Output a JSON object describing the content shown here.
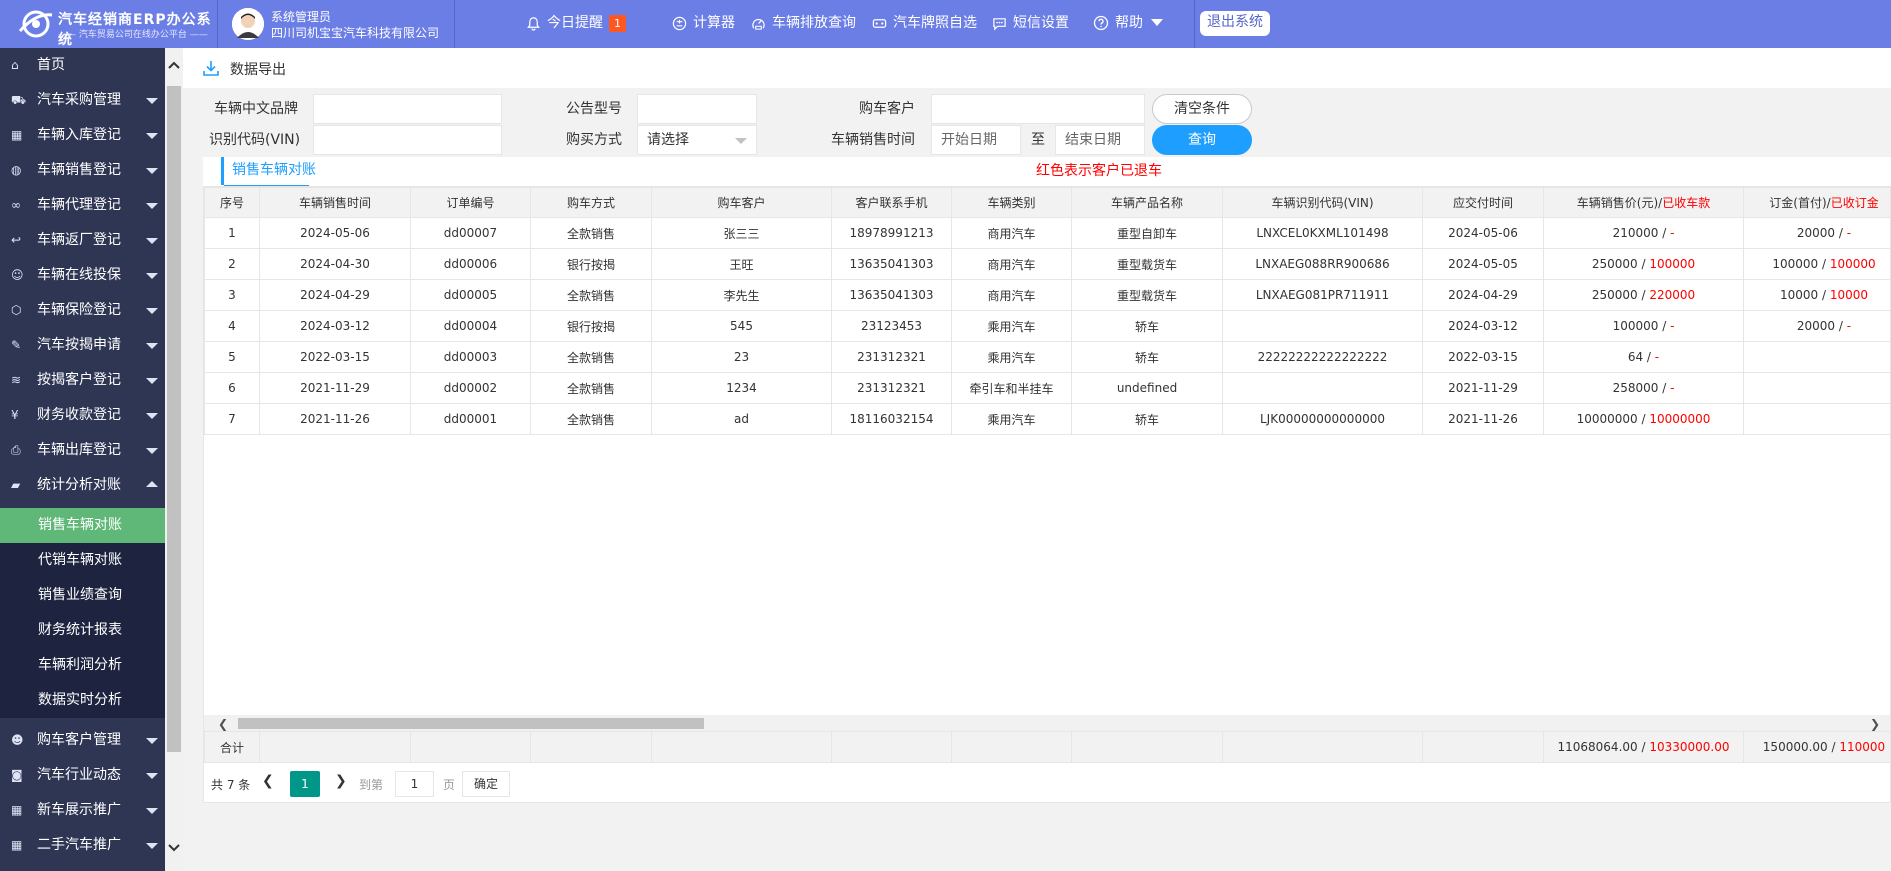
{
  "app": {
    "title": "汽车经销商ERP办公系统",
    "subtitle": "—— 汽车贸易公司在线办公平台 ——"
  },
  "user": {
    "role": "系统管理员",
    "company": "四川司机宝宝汽车科技有限公司"
  },
  "toolbar": {
    "reminder": "今日提醒",
    "reminder_count": "1",
    "calculator": "计算器",
    "emission": "车辆排放查询",
    "plate": "汽车牌照自选",
    "sms": "短信设置",
    "help": "帮助",
    "logout": "退出系统"
  },
  "sidebar": {
    "items": [
      {
        "icon": "home-icon",
        "label": "首页",
        "arrow": ""
      },
      {
        "icon": "cart-icon",
        "label": "汽车采购管理",
        "arrow": "down"
      },
      {
        "icon": "grid-icon",
        "label": "车辆入库登记",
        "arrow": "down"
      },
      {
        "icon": "globe-icon",
        "label": "车辆销售登记",
        "arrow": "down"
      },
      {
        "icon": "link-icon",
        "label": "车辆代理登记",
        "arrow": "down"
      },
      {
        "icon": "return-icon",
        "label": "车辆返厂登记",
        "arrow": "down"
      },
      {
        "icon": "smile-icon",
        "label": "车辆在线投保",
        "arrow": "down"
      },
      {
        "icon": "cube-icon",
        "label": "车辆保险登记",
        "arrow": "down"
      },
      {
        "icon": "edit-icon",
        "label": "汽车按揭申请",
        "arrow": "down"
      },
      {
        "icon": "layers-icon",
        "label": "按揭客户登记",
        "arrow": "down"
      },
      {
        "icon": "yen-icon",
        "label": "财务收款登记",
        "arrow": "down"
      },
      {
        "icon": "print-icon",
        "label": "车辆出库登记",
        "arrow": "down"
      },
      {
        "icon": "chat-icon",
        "label": "统计分析对账",
        "arrow": "up"
      }
    ],
    "subitems": [
      "销售车辆对账",
      "代销车辆对账",
      "销售业绩查询",
      "财务统计报表",
      "车辆利润分析",
      "数据实时分析"
    ],
    "bottom_items": [
      {
        "icon": "users-icon",
        "label": "购车客户管理",
        "arrow": "down"
      },
      {
        "icon": "read-icon",
        "label": "汽车行业动态",
        "arrow": "down"
      },
      {
        "icon": "grid-icon",
        "label": "新车展示推广",
        "arrow": "down"
      },
      {
        "icon": "grid-icon",
        "label": "二手汽车推广",
        "arrow": "down"
      }
    ]
  },
  "export": {
    "label": "数据导出"
  },
  "form": {
    "brand_label": "车辆中文品牌",
    "model_label": "公告型号",
    "customer_label": "购车客户",
    "vin_label": "识别代码(VIN)",
    "method_label": "购买方式",
    "method_value": "请选择",
    "time_label": "车辆销售时间",
    "start_ph": "开始日期",
    "to": "至",
    "end_ph": "结束日期",
    "clear": "清空条件",
    "query": "查询"
  },
  "tab": {
    "label": "销售车辆对账",
    "notice": "红色表示客户已退车"
  },
  "table": {
    "headers": [
      "序号",
      "车辆销售时间",
      "订单编号",
      "购车方式",
      "购车客户",
      "客户联系手机",
      "车辆类别",
      "车辆产品名称",
      "车辆识别代码(VIN)",
      "应交付时间"
    ],
    "header_price": "车辆销售价(元)/",
    "header_price_red": "已收车款",
    "header_deposit": "订金(首付)/",
    "header_deposit_red": "已收订金",
    "rows": [
      {
        "cells": [
          "1",
          "2024-05-06",
          "dd00007",
          "全款销售",
          "张三三",
          "18978991213",
          "商用汽车",
          "重型自卸车",
          "LNXCEL0KXML101498",
          "2024-05-06"
        ],
        "price": "210000 / ",
        "price_red": "-",
        "deposit": "20000 / ",
        "deposit_red": "-"
      },
      {
        "cells": [
          "2",
          "2024-04-30",
          "dd00006",
          "银行按揭",
          "王旺",
          "13635041303",
          "商用汽车",
          "重型载货车",
          "LNXAEG088RR900686",
          "2024-05-05"
        ],
        "price": "250000 / ",
        "price_red": "100000",
        "deposit": "100000 / ",
        "deposit_red": "100000"
      },
      {
        "cells": [
          "3",
          "2024-04-29",
          "dd00005",
          "全款销售",
          "李先生",
          "13635041303",
          "商用汽车",
          "重型载货车",
          "LNXAEG081PR711911",
          "2024-04-29"
        ],
        "price": "250000 / ",
        "price_red": "220000",
        "deposit": "10000 / ",
        "deposit_red": "10000"
      },
      {
        "cells": [
          "4",
          "2024-03-12",
          "dd00004",
          "银行按揭",
          "545",
          "23123453",
          "乘用汽车",
          "轿车",
          "",
          "2024-03-12"
        ],
        "price": "100000 / ",
        "price_red": "-",
        "deposit": "20000 / ",
        "deposit_red": "-"
      },
      {
        "cells": [
          "5",
          "2022-03-15",
          "dd00003",
          "全款销售",
          "23",
          "231312321",
          "乘用汽车",
          "轿车",
          "22222222222222222",
          "2022-03-15"
        ],
        "price": "64 / ",
        "price_red": "-",
        "deposit": "",
        "deposit_red": ""
      },
      {
        "cells": [
          "6",
          "2021-11-29",
          "dd00002",
          "全款销售",
          "1234",
          "231312321",
          "牵引车和半挂车",
          "undefined",
          "",
          "2021-11-29"
        ],
        "price": "258000 / ",
        "price_red": "-",
        "deposit": "",
        "deposit_red": ""
      },
      {
        "cells": [
          "7",
          "2021-11-26",
          "dd00001",
          "全款销售",
          "ad",
          "18116032154",
          "乘用汽车",
          "轿车",
          "LJK00000000000000",
          "2021-11-26"
        ],
        "price": "10000000 / ",
        "price_red": "10000000",
        "deposit": "",
        "deposit_red": ""
      }
    ],
    "total_label": "合计",
    "total_price": "11068064.00 / ",
    "total_price_red": "10330000.00",
    "total_deposit": "150000.00 / ",
    "total_deposit_red": "110000"
  },
  "pager": {
    "total": "共 7 条",
    "current": "1",
    "goto": "到第",
    "input": "1",
    "page": "页",
    "ok": "确定"
  },
  "colors": {
    "topbar": "#6b7ee6",
    "sidebar": "#2f3654",
    "active": "#5fb878",
    "primary": "#1e9fff",
    "pager_active": "#009688",
    "red": "#ff0000"
  }
}
